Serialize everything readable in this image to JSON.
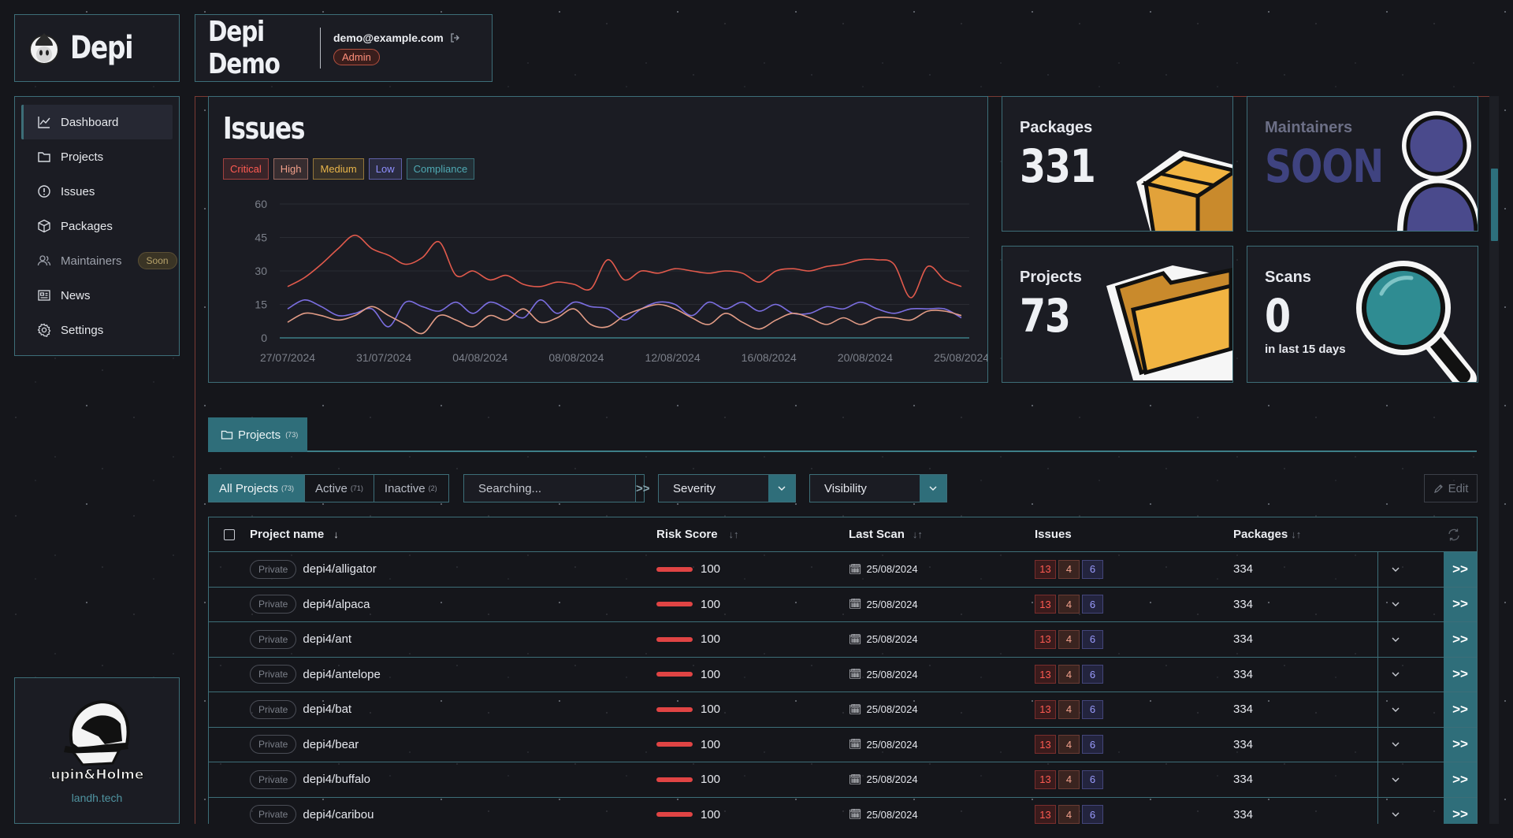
{
  "brand": {
    "name": "Depi"
  },
  "header": {
    "project_name": "Depi Demo",
    "email": "demo@example.com",
    "role_badge": "Admin"
  },
  "sidebar": {
    "items": [
      {
        "label": "Dashboard",
        "icon": "chart-line-icon"
      },
      {
        "label": "Projects",
        "icon": "folder-icon"
      },
      {
        "label": "Issues",
        "icon": "alert-circle-icon"
      },
      {
        "label": "Packages",
        "icon": "package-icon"
      },
      {
        "label": "Maintainers",
        "icon": "users-icon",
        "badge": "Soon"
      },
      {
        "label": "News",
        "icon": "newspaper-icon"
      },
      {
        "label": "Settings",
        "icon": "gear-icon"
      }
    ]
  },
  "footer_brand": {
    "logo_text": "Lupin&Holmes",
    "site": "landh.tech"
  },
  "issues_panel": {
    "title": "Issues",
    "tags": [
      {
        "label": "Critical",
        "color": "#ff5b52"
      },
      {
        "label": "High",
        "color": "#f09f8a"
      },
      {
        "label": "Medium",
        "color": "#e8b54a"
      },
      {
        "label": "Low",
        "color": "#8f8fff"
      },
      {
        "label": "Compliance",
        "color": "#4fa9b3"
      }
    ]
  },
  "chart_data": {
    "type": "line",
    "x_tick_labels": [
      "27/07/2024",
      "31/07/2024",
      "04/08/2024",
      "08/08/2024",
      "12/08/2024",
      "16/08/2024",
      "20/08/2024",
      "25/08/2024"
    ],
    "y_ticks": [
      0,
      15,
      30,
      45,
      60
    ],
    "ylim": [
      0,
      60
    ],
    "grid": true,
    "series": [
      {
        "color": "#e25a4c",
        "values": [
          23,
          27,
          33,
          40,
          46,
          40,
          37,
          33,
          36,
          43,
          28,
          30,
          26,
          28,
          24,
          23,
          25,
          24,
          22,
          35,
          26,
          30,
          29,
          31,
          30,
          29,
          30,
          29,
          25,
          30,
          31,
          30,
          32,
          33,
          35,
          35,
          33,
          18,
          32,
          26,
          23
        ]
      },
      {
        "color": "#7b6ee0",
        "values": [
          13,
          17,
          14,
          10,
          11,
          13,
          5,
          16,
          14,
          12,
          16,
          11,
          16,
          13,
          9,
          17,
          11,
          16,
          14,
          13,
          8,
          13,
          16,
          15,
          10,
          16,
          13,
          16,
          12,
          15,
          11,
          11,
          14,
          13,
          16,
          13,
          11,
          13,
          13,
          13,
          9
        ]
      },
      {
        "color": "#e39c86",
        "values": [
          7,
          11,
          10,
          8,
          10,
          14,
          10,
          6,
          2,
          10,
          8,
          5,
          10,
          8,
          13,
          7,
          9,
          13,
          6,
          5,
          10,
          13,
          15,
          13,
          9,
          6,
          11,
          7,
          4,
          8,
          11,
          9,
          6,
          9,
          6,
          9,
          9,
          8,
          12,
          12,
          10
        ]
      }
    ]
  },
  "cards": {
    "packages": {
      "label": "Packages",
      "value": "331"
    },
    "maintainers": {
      "label": "Maintainers",
      "value": "SOON"
    },
    "projects": {
      "label": "Projects",
      "value": "73"
    },
    "scans": {
      "label": "Scans",
      "value": "0",
      "sub": "in last 15 days"
    }
  },
  "projects_tab": {
    "label": "Projects",
    "count": "(73)"
  },
  "filters": {
    "segments": [
      {
        "label": "All Projects",
        "count": "(73)"
      },
      {
        "label": "Active",
        "count": "(71)"
      },
      {
        "label": "Inactive",
        "count": "(2)"
      }
    ],
    "search_placeholder": "Searching...",
    "search_go": ">>",
    "severity": "Severity",
    "visibility": "Visibility",
    "edit": "Edit"
  },
  "table": {
    "headers": {
      "name": "Project name",
      "risk": "Risk Score",
      "scan": "Last Scan",
      "issues": "Issues",
      "packages": "Packages"
    },
    "rows": [
      {
        "visibility": "Private",
        "name": "depi4/alligator",
        "risk": "100",
        "scan": "25/08/2024",
        "critical": "13",
        "high": "4",
        "medium": "6",
        "packages": "334"
      },
      {
        "visibility": "Private",
        "name": "depi4/alpaca",
        "risk": "100",
        "scan": "25/08/2024",
        "critical": "13",
        "high": "4",
        "medium": "6",
        "packages": "334"
      },
      {
        "visibility": "Private",
        "name": "depi4/ant",
        "risk": "100",
        "scan": "25/08/2024",
        "critical": "13",
        "high": "4",
        "medium": "6",
        "packages": "334"
      },
      {
        "visibility": "Private",
        "name": "depi4/antelope",
        "risk": "100",
        "scan": "25/08/2024",
        "critical": "13",
        "high": "4",
        "medium": "6",
        "packages": "334"
      },
      {
        "visibility": "Private",
        "name": "depi4/bat",
        "risk": "100",
        "scan": "25/08/2024",
        "critical": "13",
        "high": "4",
        "medium": "6",
        "packages": "334"
      },
      {
        "visibility": "Private",
        "name": "depi4/bear",
        "risk": "100",
        "scan": "25/08/2024",
        "critical": "13",
        "high": "4",
        "medium": "6",
        "packages": "334"
      },
      {
        "visibility": "Private",
        "name": "depi4/buffalo",
        "risk": "100",
        "scan": "25/08/2024",
        "critical": "13",
        "high": "4",
        "medium": "6",
        "packages": "334"
      },
      {
        "visibility": "Private",
        "name": "depi4/caribou",
        "risk": "100",
        "scan": "25/08/2024",
        "critical": "13",
        "high": "4",
        "medium": "6",
        "packages": "334"
      }
    ]
  }
}
